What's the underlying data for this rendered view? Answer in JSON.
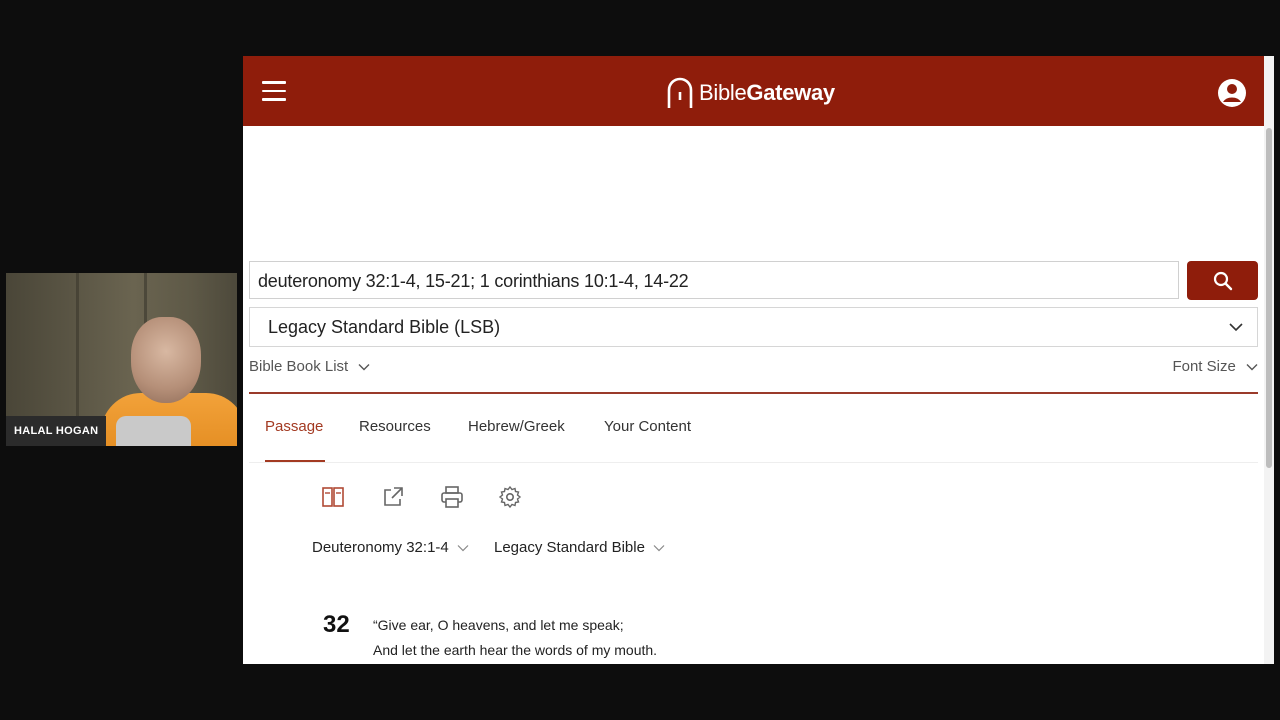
{
  "webcam": {
    "name": "HALAL HOGAN"
  },
  "header": {
    "brand_light": "Bible",
    "brand_bold": "Gateway"
  },
  "search": {
    "query": "deuteronomy 32:1-4, 15-21; 1 corinthians 10:1-4, 14-22"
  },
  "version": {
    "selected": "Legacy Standard Bible (LSB)"
  },
  "links": {
    "book_list": "Bible Book List",
    "font_size": "Font Size"
  },
  "tabs": [
    {
      "label": "Passage"
    },
    {
      "label": "Resources"
    },
    {
      "label": "Hebrew/Greek"
    },
    {
      "label": "Your Content"
    }
  ],
  "passage": {
    "reference": "Deuteronomy 32:1-4",
    "translation": "Legacy Standard Bible",
    "chapter": "32",
    "lines": [
      "“Give ear, O heavens, and let me speak;",
      "And let the earth hear the words of my mouth."
    ]
  },
  "colors": {
    "brand": "#8f1d0b",
    "accent": "#a33a22"
  },
  "icons": [
    "menu-icon",
    "user-icon",
    "search-icon",
    "parallel-icon",
    "share-icon",
    "print-icon",
    "settings-icon",
    "chevron-down-icon"
  ]
}
